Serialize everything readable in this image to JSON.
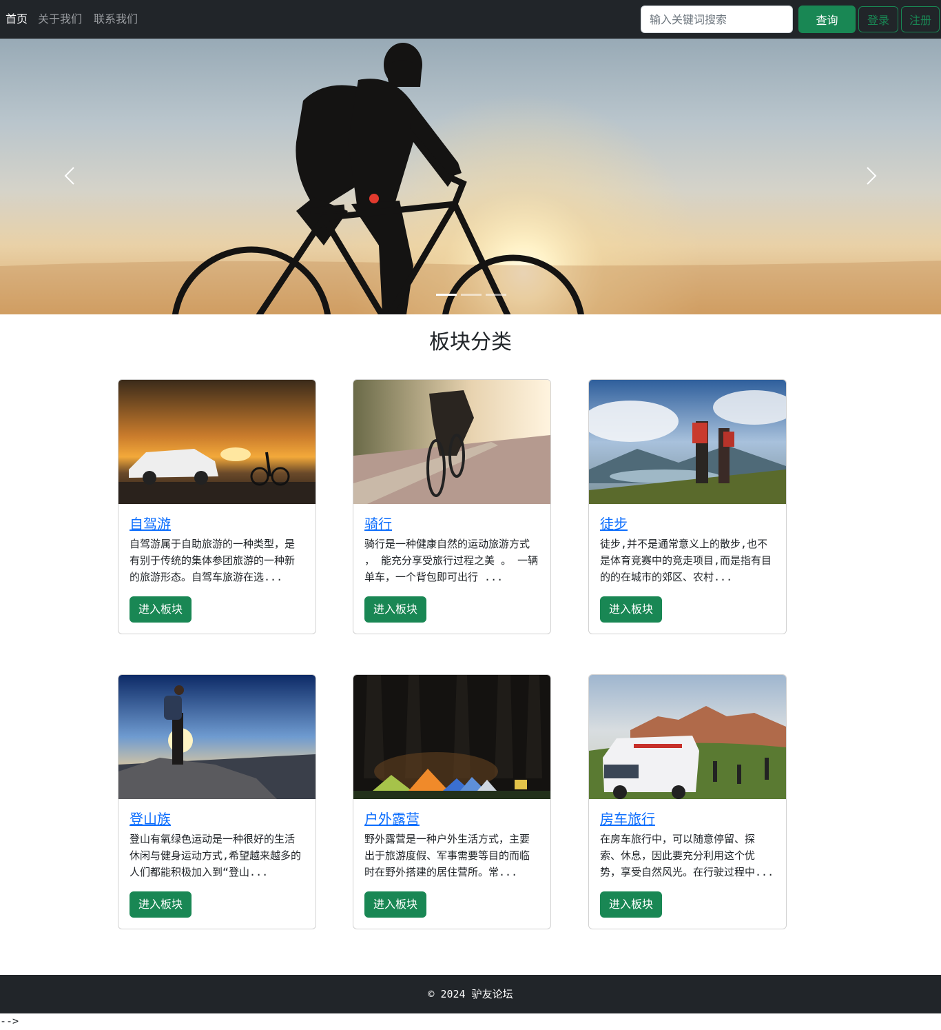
{
  "nav": {
    "links": [
      "首页",
      "关于我们",
      "联系我们"
    ],
    "search_placeholder": "输入关键词搜索",
    "query_button": "查询",
    "login_button": "登录",
    "register_button": "注册"
  },
  "carousel": {
    "prev_icon": "chevron-left-icon",
    "next_icon": "chevron-right-icon",
    "slides": 3,
    "active_slide": 1
  },
  "section": {
    "title": "板块分类"
  },
  "cards": [
    {
      "title": "自驾游",
      "text": "自驾游属于自助旅游的一种类型，是有别于传统的集体参团旅游的一种新的旅游形态。自驾车旅游在选...",
      "button": "进入板块"
    },
    {
      "title": "骑行",
      "text": "骑行是一种健康自然的运动旅游方式 ， 能充分享受旅行过程之美 。 一辆单车，一个背包即可出行 ...",
      "button": "进入板块"
    },
    {
      "title": "徒步",
      "text": "徒步,并不是通常意义上的散步,也不是体育竞赛中的竞走项目,而是指有目的的在城市的郊区、农村...",
      "button": "进入板块"
    },
    {
      "title": "登山族",
      "text": "登山有氧绿色运动是一种很好的生活休闲与健身运动方式,希望越来越多的人们都能积极加入到“登山...",
      "button": "进入板块"
    },
    {
      "title": "户外露营",
      "text": "野外露营是一种户外生活方式，主要出于旅游度假、军事需要等目的而临时在野外搭建的居住营所。常...",
      "button": "进入板块"
    },
    {
      "title": "房车旅行",
      "text": "在房车旅行中，可以随意停留、探索、休息，因此要充分利用这个优势，享受自然风光。在行驶过程中...",
      "button": "进入板块"
    }
  ],
  "footer": {
    "text": "© 2024 驴友论坛"
  },
  "stray_text": "-->",
  "colors": {
    "primary_green": "#198754",
    "nav_bg": "#212529",
    "link_blue": "#0d6efd"
  }
}
